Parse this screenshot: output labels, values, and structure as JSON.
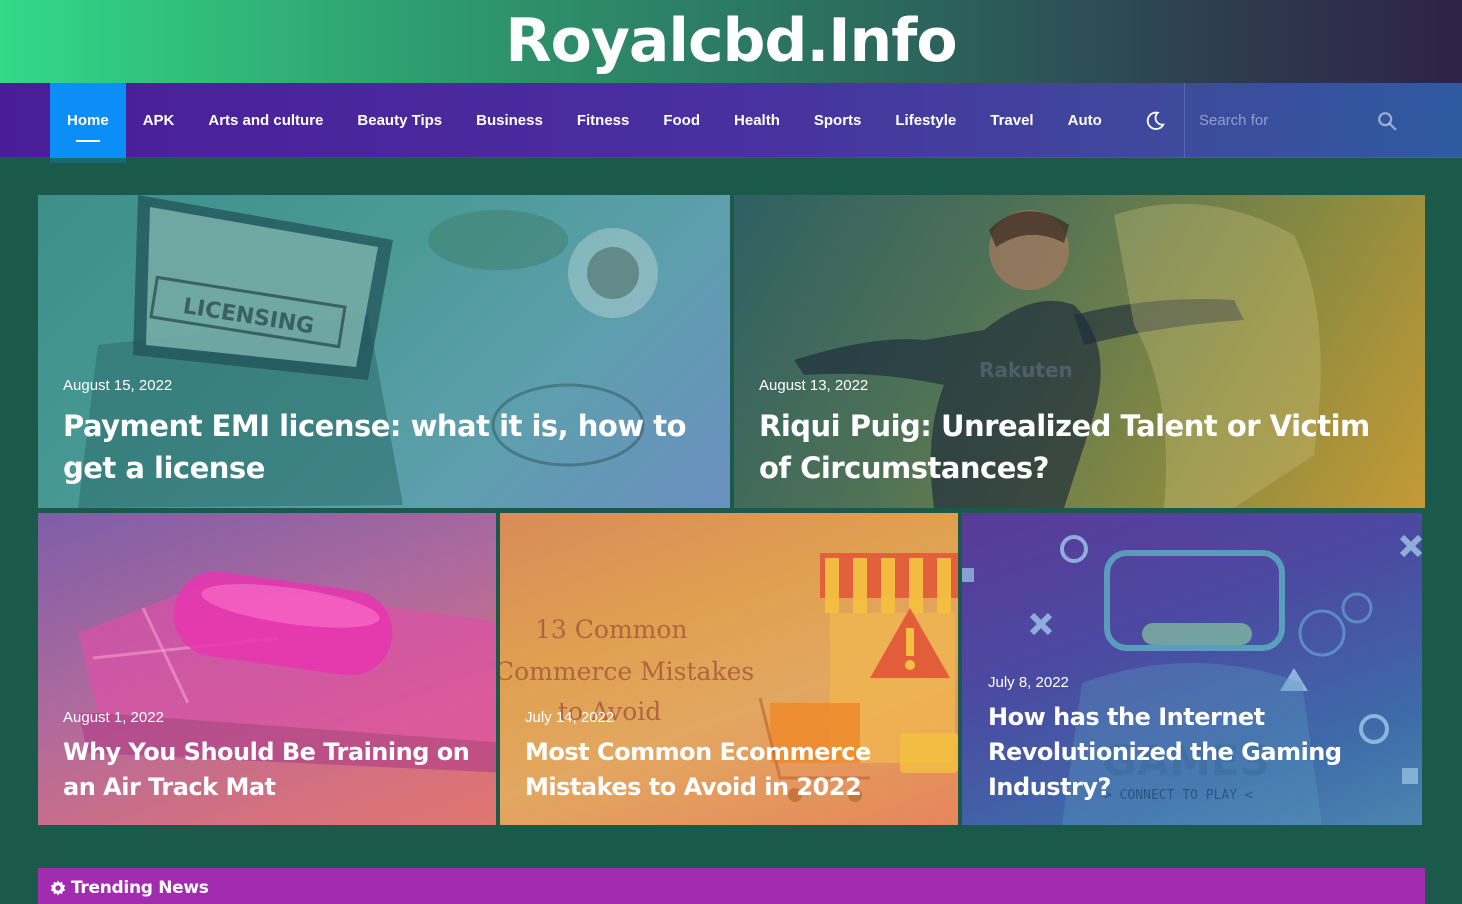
{
  "site": {
    "title": "Royalcbd.Info"
  },
  "nav": {
    "items": [
      {
        "label": "Home",
        "active": true
      },
      {
        "label": "APK"
      },
      {
        "label": "Arts and culture"
      },
      {
        "label": "Beauty Tips"
      },
      {
        "label": "Business"
      },
      {
        "label": "Fitness"
      },
      {
        "label": "Food"
      },
      {
        "label": "Health"
      },
      {
        "label": "Sports"
      },
      {
        "label": "Lifestyle"
      },
      {
        "label": "Travel"
      },
      {
        "label": "Auto"
      }
    ],
    "dark_mode_icon": "moon-icon",
    "search": {
      "placeholder": "Search for",
      "icon": "search-icon"
    }
  },
  "posts": [
    {
      "date": "August 15, 2022",
      "title": "Payment EMI license: what it is, how to get a license",
      "image_text": "LICENSING"
    },
    {
      "date": "August 13, 2022",
      "title": "Riqui Puig: Unrealized Talent or Victim of Circumstances?",
      "image_text": "Rakuten"
    },
    {
      "date": "August 1, 2022",
      "title": "Why You Should Be Training on an Air Track Mat"
    },
    {
      "date": "July 14, 2022",
      "title": "Most Common Ecommerce Mistakes to Avoid in 2022",
      "image_text_1": "13 Common",
      "image_text_2": "Commerce Mistakes",
      "image_text_3": "to Avoid"
    },
    {
      "date": "July 8, 2022",
      "title": "How has the Internet Revolutionized the Gaming Industry?",
      "image_text_1": "GAMES",
      "image_text_2": "> CONNECT TO PLAY <"
    }
  ],
  "trending": {
    "label": "Trending News",
    "icon": "gear-icon"
  },
  "colors": {
    "nav_active": "#0b8ef5",
    "trending_bar": "#a12cb0",
    "page_bg": "#1b5a4a"
  }
}
